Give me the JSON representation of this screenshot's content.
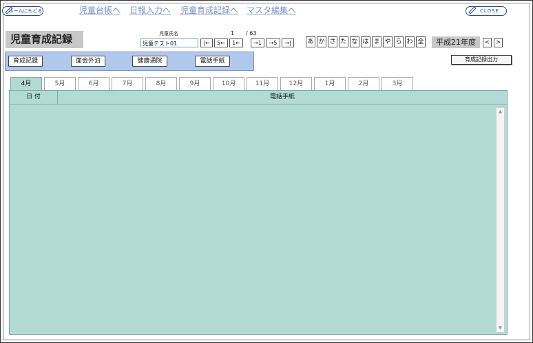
{
  "header": {
    "home_label": "ホームにもどる",
    "close_label": "CLOSE",
    "nav_links": [
      "児童台帳へ",
      "日報入力へ",
      "児童育成記録へ",
      "マスタ編集へ"
    ]
  },
  "page_title": "児童育成記録",
  "child": {
    "name_label": "児童氏名",
    "name_value": "児童テスト01",
    "record_index": "1",
    "record_total": "/ 63",
    "nav_buttons": [
      "|←",
      "5←",
      "1←",
      "→1",
      "→5",
      "→|"
    ]
  },
  "kana_filters": [
    "あ",
    "か",
    "さ",
    "た",
    "な",
    "は",
    "ま",
    "や",
    "ら",
    "わ",
    "全"
  ],
  "fiscal_year": {
    "label": "平成21年度",
    "prev": "<",
    "next": ">"
  },
  "menu": {
    "buttons": [
      "育成記録",
      "面会外泊",
      "健康通院",
      "電話手紙"
    ]
  },
  "export_button": "育成記録出力",
  "months": [
    "4月",
    "5月",
    "6月",
    "7月",
    "8月",
    "9月",
    "10月",
    "11月",
    "12月",
    "1月",
    "2月",
    "3月"
  ],
  "active_month": "4月",
  "table": {
    "columns": [
      "日 付",
      "電話手紙"
    ]
  },
  "colors": {
    "grid_bg": "#b2dbd6",
    "menubar_bg": "#b0c8ec",
    "link": "#7b93c5"
  }
}
